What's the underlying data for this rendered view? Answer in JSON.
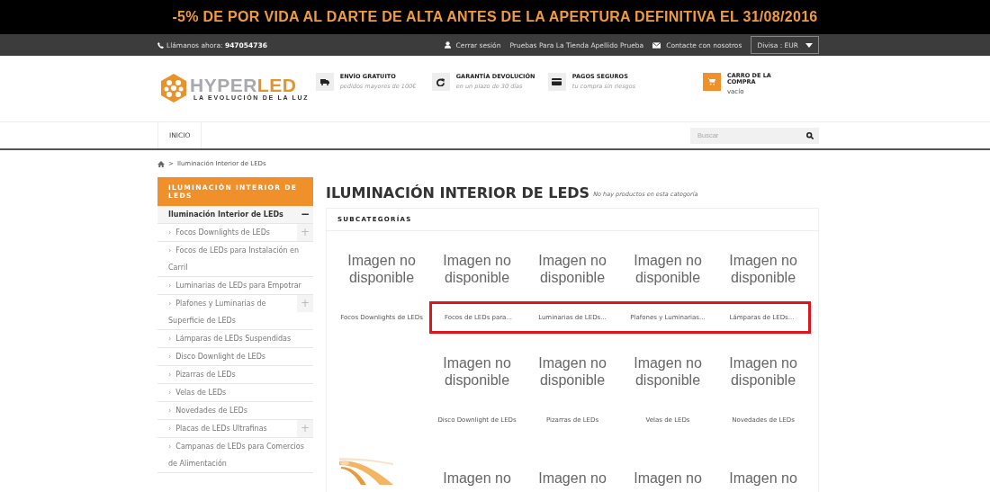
{
  "promo_banner": "-5% DE POR VIDA AL DARTE DE ALTA ANTES DE LA APERTURA DEFINITIVA EL 31/08/2016",
  "top_bar": {
    "phone_label": "Llámanos ahora:",
    "phone": "947054736",
    "links": [
      {
        "kind": "user",
        "label": "Cerrar sesión"
      },
      {
        "kind": "plain",
        "label": "Pruebas Para La Tienda Apellido Prueba"
      },
      {
        "kind": "mail",
        "label": "Contacte con nosotros"
      }
    ],
    "currency": "Divisa : EUR"
  },
  "logo": {
    "text_gray": "HYPER",
    "text_orange": "LED",
    "tagline": "LA EVOLUCIÓN DE LA LUZ"
  },
  "features": [
    {
      "kind": "truck",
      "title": "ENVÍO GRATUITO",
      "subtitle": "pedidos mayores de 100€"
    },
    {
      "kind": "refresh",
      "title": "GARANTÍA DEVOLUCIÓN",
      "subtitle": "en un plazo de 30 días"
    },
    {
      "kind": "card",
      "title": "PAGOS SEGUROS",
      "subtitle": "tu compra sin riesgos"
    }
  ],
  "cart": {
    "title": "CARRO DE LA COMPRA",
    "status": "vacío"
  },
  "nav": {
    "items": [
      {
        "label": "INICIO",
        "selected": false
      }
    ],
    "search": {
      "placeholder": "Buscar"
    }
  },
  "breadcrumb": {
    "separator": ">",
    "current": "Iluminación Interior de LEDs"
  },
  "sidebar": {
    "title": "ILUMINACIÓN INTERIOR DE LEDS",
    "tree": [
      {
        "label": "Iluminación Interior de LEDs",
        "toggle": "−",
        "children": [
          {
            "marker": "›",
            "label": "Focos Downlights de LEDs",
            "toggle": "+"
          },
          {
            "marker": "›",
            "label": "Focos de LEDs para Instalación en Carril"
          },
          {
            "marker": "›",
            "label": "Luminarias de LEDs para Empotrar"
          },
          {
            "marker": "›",
            "label": "Plafones y Luminarias de Superficie de LEDs",
            "toggle": "+"
          },
          {
            "marker": "›",
            "label": "Lámparas de LEDs Suspendidas"
          },
          {
            "marker": "›",
            "label": "Disco Downlight de LEDs"
          },
          {
            "marker": "›",
            "label": "Pizarras de LEDs"
          },
          {
            "marker": "›",
            "label": "Velas de LEDs"
          },
          {
            "marker": "›",
            "label": "Novedades de LEDs"
          },
          {
            "marker": "›",
            "label": "Placas de LEDs Ultrafinas",
            "toggle": "+"
          },
          {
            "marker": "›",
            "label": "Campanas de LEDs para Comercios de Alimentación"
          }
        ]
      }
    ]
  },
  "page_title": "ILUMINACIÓN INTERIOR DE LEDS",
  "no_products": "No hay productos en esta categoría",
  "subcategories": {
    "title": "SUBCATEGORÍAS",
    "rows": [
      [
        {
          "kind": "item",
          "image_text": "Imagen no disponible",
          "label": "Focos Downlights de LEDs",
          "highlighted": false
        },
        {
          "kind": "item",
          "image_text": "Imagen no disponible",
          "label": "Focos de LEDs para...",
          "highlighted": true
        },
        {
          "kind": "item",
          "image_text": "Imagen no disponible",
          "label": "Luminarias de LEDs...",
          "highlighted": true
        },
        {
          "kind": "item",
          "image_text": "Imagen no disponible",
          "label": "Plafones y Luminarias...",
          "highlighted": true
        },
        {
          "kind": "item",
          "image_text": "Imagen no disponible",
          "label": "Lámparas de LEDs...",
          "highlighted": true
        }
      ],
      [
        {
          "kind": "empty"
        },
        {
          "kind": "item",
          "image_text": "Imagen no disponible",
          "label": "Disco Downlight de LEDs",
          "highlighted": false
        },
        {
          "kind": "item",
          "image_text": "Imagen no disponible",
          "label": "Pizarras de LEDs",
          "highlighted": false
        },
        {
          "kind": "item",
          "image_text": "Imagen no disponible",
          "label": "Velas de LEDs",
          "highlighted": false
        },
        {
          "kind": "item",
          "image_text": "Imagen no disponible",
          "label": "Novedades de LEDs",
          "highlighted": false
        }
      ],
      [
        {
          "kind": "picture"
        },
        {
          "kind": "item",
          "image_text": "Imagen no"
        },
        {
          "kind": "item",
          "image_text": "Imagen no"
        },
        {
          "kind": "item",
          "image_text": "Imagen no"
        },
        {
          "kind": "item",
          "image_text": "Imagen no"
        }
      ]
    ]
  }
}
